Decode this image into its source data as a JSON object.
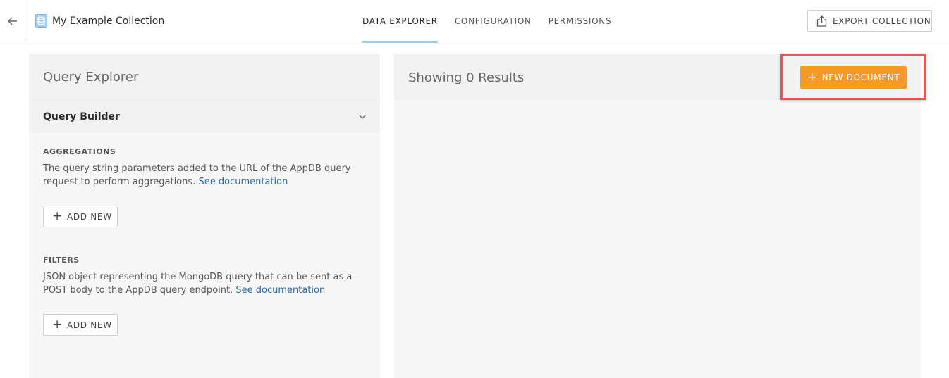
{
  "header": {
    "collection_title": "My Example Collection",
    "collection_icon": "database-icon",
    "back_icon": "arrow-left-icon",
    "tabs": [
      {
        "label": "DATA EXPLORER",
        "active": true
      },
      {
        "label": "CONFIGURATION",
        "active": false
      },
      {
        "label": "PERMISSIONS",
        "active": false
      }
    ],
    "export_label": "EXPORT COLLECTION",
    "export_icon": "share-upload-icon"
  },
  "query_explorer": {
    "title": "Query Explorer",
    "builder_label": "Query Builder",
    "builder_icon": "chevron-down-icon",
    "aggregations": {
      "title": "AGGREGATIONS",
      "description": "The query string parameters added to the URL of the AppDB query request to perform aggregations.",
      "link": "See documentation",
      "add_label": "ADD NEW"
    },
    "filters": {
      "title": "FILTERS",
      "description": "JSON object representing the MongoDB query that can be sent as a POST body to the AppDB query endpoint.",
      "link": "See documentation",
      "add_label": "ADD NEW"
    }
  },
  "results": {
    "title": "Showing 0 Results",
    "new_document_label": "NEW DOCUMENT",
    "highlight_color": "#e05a52",
    "button_color": "#f5992b"
  }
}
